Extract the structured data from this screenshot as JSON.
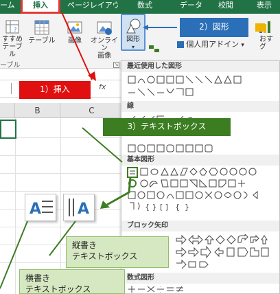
{
  "tabs": [
    "ーム",
    "挿入",
    "ページレイアウト",
    "数式",
    "データ",
    "校閲",
    "表示"
  ],
  "ribbon": {
    "recommended_tables": "すすめ\nテーブル",
    "table": "テーブル",
    "picture": "画像",
    "online_picture": "オンライン\n画像",
    "shapes": "図形",
    "addins": "個人用アドイン",
    "recommended_charts": "おす\nグ",
    "group_table": "ーブル"
  },
  "formula_bar": {
    "fx": "fx"
  },
  "grid": {
    "columns": [
      "B",
      "C"
    ]
  },
  "shapes_panel": {
    "sections": [
      "最近使用した図形",
      "線",
      "基本図形",
      "ブロック矢印",
      "数式図形"
    ]
  },
  "callouts": {
    "insert": "1）挿入",
    "shapes": "2）図形",
    "textbox": "3）テキストボックス",
    "vertical": "縦書き\nテキストボックス",
    "horizontal": "横書き\nテキストボックス"
  },
  "colors": {
    "ribbon_green": "#217346",
    "red": "#e01010",
    "blue": "#2a6fb7",
    "green": "#3c7d22",
    "light_green": "#d6e8c2"
  }
}
